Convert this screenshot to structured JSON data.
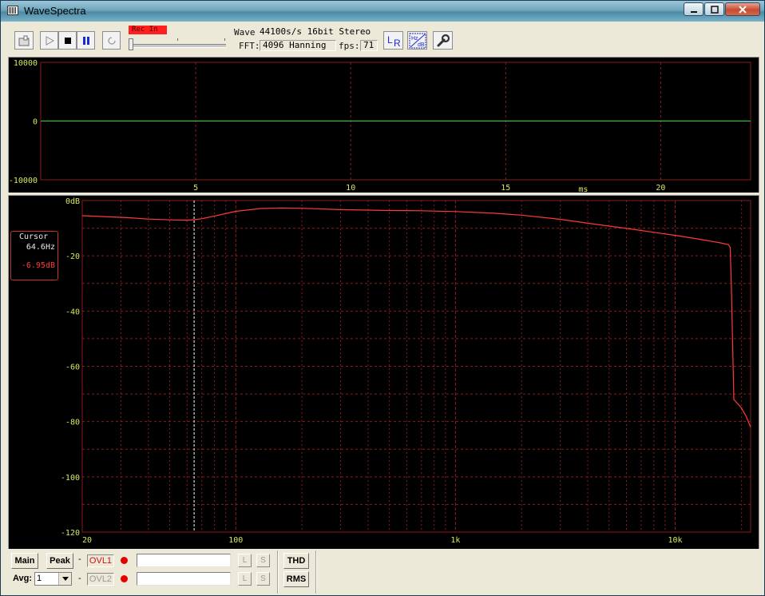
{
  "window": {
    "title": "WaveSpectra"
  },
  "toolbar": {
    "rec_input_label": "Rec In",
    "rec_level": 0.0,
    "wave_label": "Wave:",
    "wave_value": "44100s/s 16bit Stereo",
    "fft_label": "FFT:",
    "fft_value": "4096 Hanning",
    "fps_label": "fps:",
    "fps_value": "71",
    "lr_label": "LR",
    "hz_label": "Hz",
    "db_label": "dB"
  },
  "wave_panel": {
    "ylim": [
      -10000,
      10000
    ],
    "ytick_labels": [
      "10000",
      "0",
      "-10000"
    ],
    "xticks": [
      5,
      10,
      15,
      20
    ],
    "xunit": "ms",
    "xlim": [
      0,
      22.9
    ],
    "trace_value": 0,
    "colors": {
      "grid": "#8a1c1c",
      "trace": "#2ed82e",
      "tick_text": "#d9e85c"
    }
  },
  "spectrum_panel": {
    "ytick_labels": [
      "0dB",
      "-20",
      "-40",
      "-60",
      "-80",
      "-100",
      "-120"
    ],
    "xtick_labels": [
      "20",
      "100",
      "1k",
      "10k"
    ],
    "xticks_hz": [
      20,
      100,
      1000,
      10000
    ],
    "xlim_hz": [
      20,
      22050
    ],
    "ylim_db": [
      -120,
      0
    ],
    "cursor_hz": 64.6,
    "colors": {
      "grid": "#8a1c1c",
      "trace": "#ff3a3a",
      "cursor": "#ffffff",
      "tick_text": "#d9e85c"
    }
  },
  "cursor_readout": {
    "label": "Cursor",
    "freq": "64.6Hz",
    "level": "-6.95dB"
  },
  "chart_data": {
    "type": "line",
    "series": [
      {
        "x": [
          20,
          25,
          32,
          40,
          50,
          60,
          64.6,
          70,
          80,
          100,
          130,
          160,
          200,
          300,
          500,
          700,
          1000,
          1500,
          2000,
          3000,
          4000,
          6000,
          8000,
          10000,
          12000,
          14000,
          16000,
          17500,
          17800,
          18000,
          18300,
          18500,
          19000,
          20000,
          21000,
          22050
        ],
        "y": [
          -5.5,
          -5.8,
          -6.2,
          -6.7,
          -7.0,
          -7.1,
          -6.95,
          -6.6,
          -5.6,
          -3.9,
          -2.9,
          -2.7,
          -2.8,
          -3.3,
          -3.6,
          -3.7,
          -4.0,
          -4.6,
          -5.3,
          -6.8,
          -8.2,
          -10.1,
          -11.5,
          -12.6,
          -13.6,
          -14.5,
          -15.3,
          -16.0,
          -17,
          -30,
          -55,
          -72,
          -73,
          -75,
          -78,
          -82
        ]
      }
    ],
    "xlabel": "",
    "ylabel": "",
    "xscale": "log",
    "xlim": [
      20,
      22050
    ],
    "ylim": [
      -120,
      0
    ],
    "grid": true
  },
  "bottom": {
    "main_label": "Main",
    "peak_label": "Peak",
    "avg_label": "Avg:",
    "avg_value": "1",
    "dash": "-",
    "ovl1_label": "OVL1",
    "ovl2_label": "OVL2",
    "l_label": "L",
    "s_label": "S",
    "thd_label": "THD",
    "rms_label": "RMS",
    "colors": {
      "ovl1": "#d01010",
      "ovl2": "#9a9a9a",
      "record_dot": "#e30000"
    }
  }
}
